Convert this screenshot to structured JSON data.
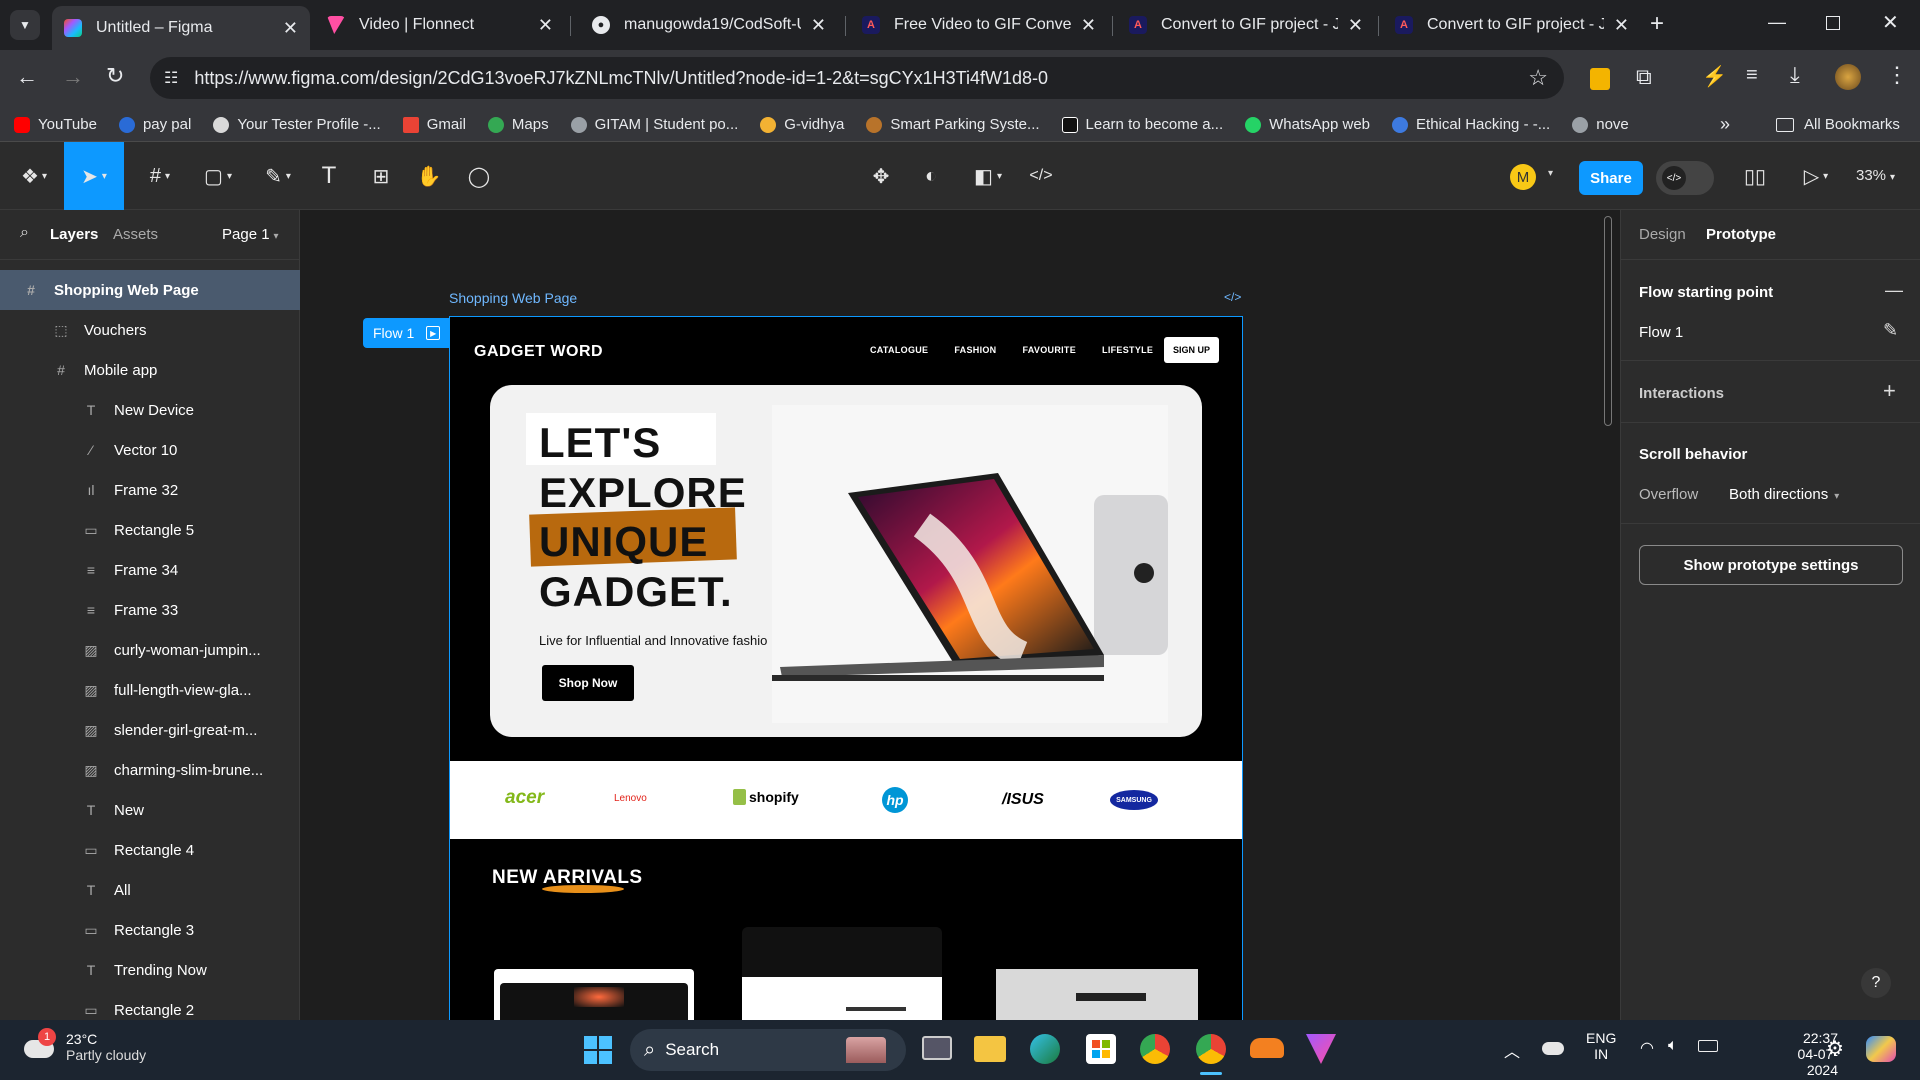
{
  "browser": {
    "tabs": [
      {
        "title": "Untitled – Figma",
        "active": true
      },
      {
        "title": "Video | Flonnect",
        "active": false
      },
      {
        "title": "manugowda19/CodSoft-U",
        "active": false
      },
      {
        "title": "Free Video to GIF Converte",
        "active": false
      },
      {
        "title": "Convert to GIF project - Ju",
        "active": false
      },
      {
        "title": "Convert to GIF project - Ju",
        "active": false
      }
    ],
    "url": "https://www.figma.com/design/2CdG13voeRJ7kZNLmcTNlv/Untitled?node-id=1-2&t=sgCYx1H3Ti4fW1d8-0",
    "bookmarks": [
      "YouTube",
      "pay pal",
      "Your Tester Profile -...",
      "Gmail",
      "Maps",
      "GITAM | Student po...",
      "G-vidhya",
      "Smart Parking Syste...",
      "Learn to become a...",
      "WhatsApp web",
      "Ethical Hacking - -...",
      "nove"
    ],
    "all_bookmarks": "All Bookmarks"
  },
  "figma_toolbar": {
    "share_label": "Share",
    "avatar_initial": "M",
    "zoom": "33%",
    "icons": [
      "figma-menu-icon",
      "move-tool-icon",
      "frame-tool-icon",
      "shape-tool-icon",
      "pen-tool-icon",
      "text-tool-icon",
      "resources-icon",
      "hand-tool-icon",
      "comment-icon",
      "component-icon",
      "contrast-icon",
      "boolean-icon",
      "code-icon",
      "dev-mode-icon",
      "library-icon",
      "present-icon"
    ]
  },
  "left_panel": {
    "tab_layers": "Layers",
    "tab_assets": "Assets",
    "page": "Page 1",
    "layers": [
      {
        "name": "Shopping Web Page",
        "icon": "#",
        "depth": 0,
        "selected": true
      },
      {
        "name": "Vouchers",
        "icon": "⬚",
        "depth": 1
      },
      {
        "name": "Mobile app",
        "icon": "#",
        "depth": 1
      },
      {
        "name": "New Device",
        "icon": "T",
        "depth": 2
      },
      {
        "name": "Vector 10",
        "icon": "⁄",
        "depth": 2
      },
      {
        "name": "Frame 32",
        "icon": "ıl",
        "depth": 2
      },
      {
        "name": "Rectangle 5",
        "icon": "▭",
        "depth": 2
      },
      {
        "name": "Frame 34",
        "icon": "≡",
        "depth": 2
      },
      {
        "name": "Frame 33",
        "icon": "≡",
        "depth": 2
      },
      {
        "name": "curly-woman-jumpin...",
        "icon": "▨",
        "depth": 2
      },
      {
        "name": "full-length-view-gla...",
        "icon": "▨",
        "depth": 2
      },
      {
        "name": "slender-girl-great-m...",
        "icon": "▨",
        "depth": 2
      },
      {
        "name": "charming-slim-brune...",
        "icon": "▨",
        "depth": 2
      },
      {
        "name": "New",
        "icon": "T",
        "depth": 2
      },
      {
        "name": "Rectangle 4",
        "icon": "▭",
        "depth": 2
      },
      {
        "name": "All",
        "icon": "T",
        "depth": 2
      },
      {
        "name": "Rectangle 3",
        "icon": "▭",
        "depth": 2
      },
      {
        "name": "Trending Now",
        "icon": "T",
        "depth": 2
      },
      {
        "name": "Rectangle 2",
        "icon": "▭",
        "depth": 2
      }
    ]
  },
  "canvas": {
    "frame_label": "Shopping Web Page",
    "flow_label": "Flow 1",
    "site": {
      "logo": "GADGET WORD",
      "nav": [
        "CATALOGUE",
        "FASHION",
        "FAVOURITE",
        "LIFESTYLE"
      ],
      "signup": "SIGN UP",
      "hero_lines": [
        "LET'S",
        "EXPLORE",
        "UNIQUE",
        "GADGET."
      ],
      "tagline": "Live for Influential and Innovative fashio",
      "cta": "Shop Now",
      "brands": [
        "acer",
        "Lenovo",
        "shopify",
        "hp",
        "/ISUS",
        "SAMSUNG"
      ],
      "section_title": "NEW ARRIVALS"
    }
  },
  "right_panel": {
    "tab_design": "Design",
    "tab_prototype": "Prototype",
    "flow_start": "Flow starting point",
    "flow_name": "Flow 1",
    "interactions": "Interactions",
    "scroll_behavior": "Scroll behavior",
    "overflow_label": "Overflow",
    "overflow_value": "Both directions",
    "settings_button": "Show prototype settings",
    "help": "?"
  },
  "taskbar": {
    "weather_temp": "23°C",
    "weather_desc": "Partly cloudy",
    "weather_badge": "1",
    "search": "Search",
    "lang1": "ENG",
    "lang2": "IN",
    "time": "22:37",
    "date": "04-07-2024"
  }
}
